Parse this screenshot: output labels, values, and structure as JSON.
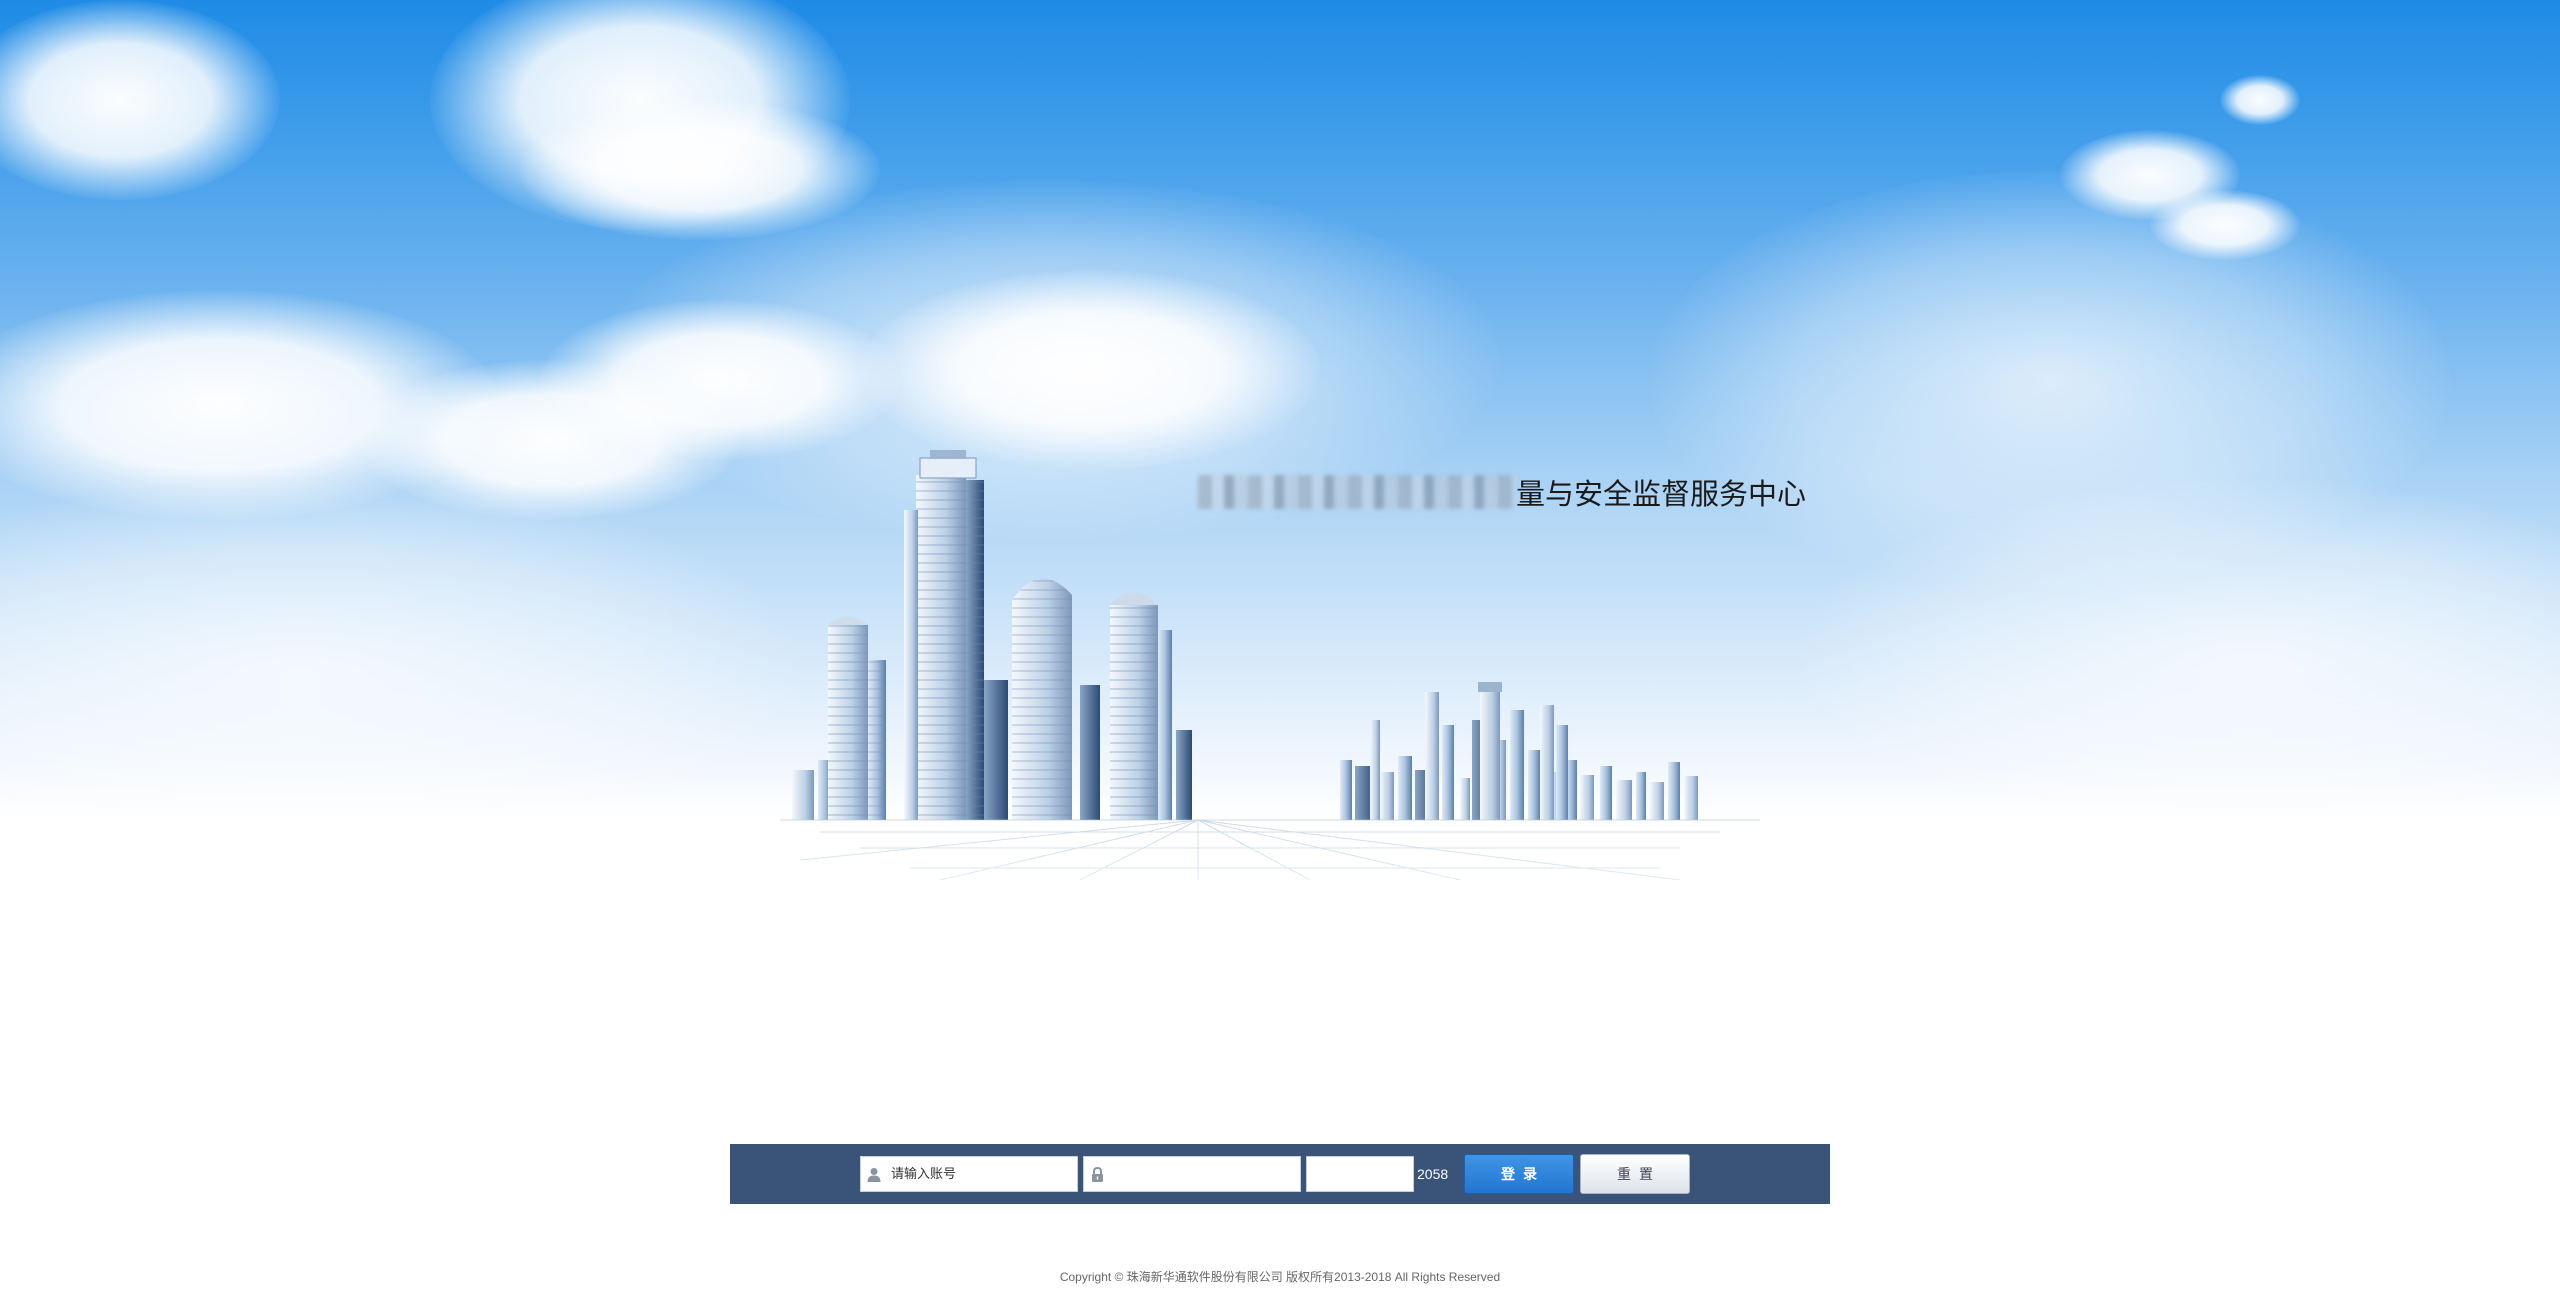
{
  "header": {
    "title_visible_suffix": "量与安全监督服务中心"
  },
  "login": {
    "username_placeholder": "请输入账号",
    "password_placeholder": "",
    "captcha_placeholder": "",
    "captcha_code": "2058",
    "login_label": "登录",
    "reset_label": "重置"
  },
  "icons": {
    "username": "user-icon",
    "password": "lock-icon"
  },
  "colors": {
    "login_bar": "#3a5479",
    "login_button": "#2a7fd8",
    "sky_top": "#1f8be6"
  },
  "footer": {
    "copyright": "Copyright © 珠海新华通软件股份有限公司 版权所有2013-2018 All Rights Reserved"
  }
}
